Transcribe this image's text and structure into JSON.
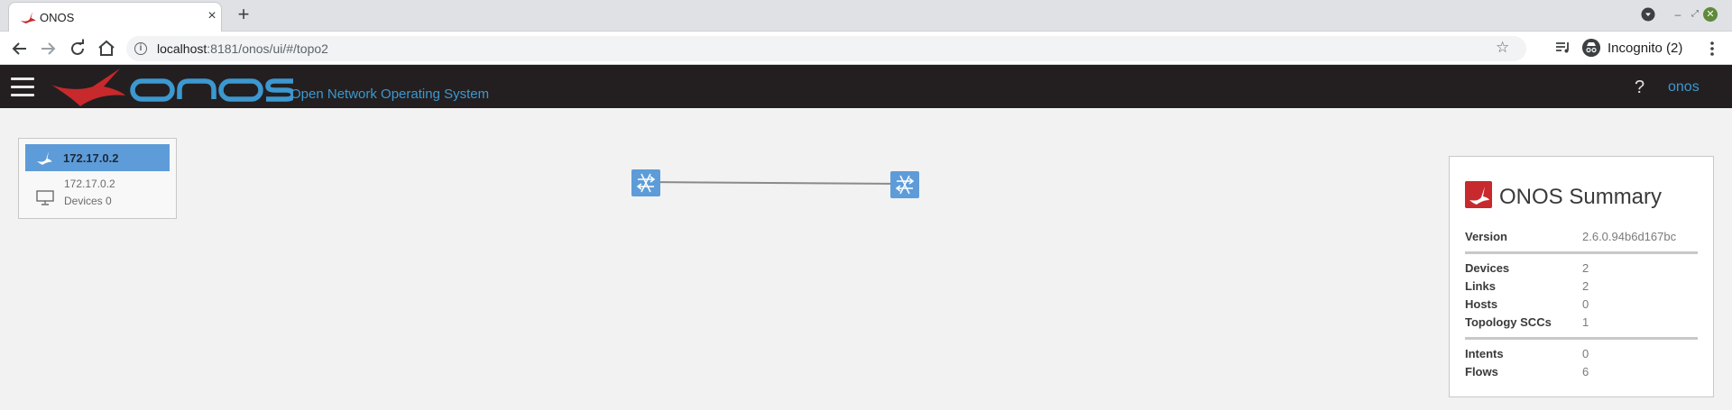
{
  "browser": {
    "tab_title": "ONOS",
    "tab_close": "×",
    "new_tab": "+",
    "url_host": "localhost",
    "url_rest": ":8181/onos/ui/#/topo2",
    "incognito_label": "Incognito (2)",
    "win_minimize": "–",
    "win_restore": "⤢",
    "win_close": "✕"
  },
  "masthead": {
    "subtitle": "Open Network Operating System",
    "help": "?",
    "user": "onos",
    "logo_text": "ONOS"
  },
  "cluster": {
    "header": "172.17.0.2",
    "ip": "172.17.0.2",
    "devices": "Devices 0"
  },
  "topology": {
    "devices": [
      {
        "id": "device-1"
      },
      {
        "id": "device-2"
      }
    ],
    "links": [
      {
        "from": "device-1",
        "to": "device-2"
      }
    ]
  },
  "summary": {
    "title": "ONOS Summary",
    "groups": [
      [
        {
          "key": "Version",
          "value": "2.6.0.94b6d167bc"
        }
      ],
      [
        {
          "key": "Devices",
          "value": "2"
        },
        {
          "key": "Links",
          "value": "2"
        },
        {
          "key": "Hosts",
          "value": "0"
        },
        {
          "key": "Topology SCCs",
          "value": "1"
        }
      ],
      [
        {
          "key": "Intents",
          "value": "0"
        },
        {
          "key": "Flows",
          "value": "6"
        }
      ]
    ]
  },
  "colors": {
    "accent_blue": "#3c98d0",
    "masthead_bg": "#231f20",
    "device_blue": "#5d9cd9",
    "onos_red": "#c7292c"
  }
}
